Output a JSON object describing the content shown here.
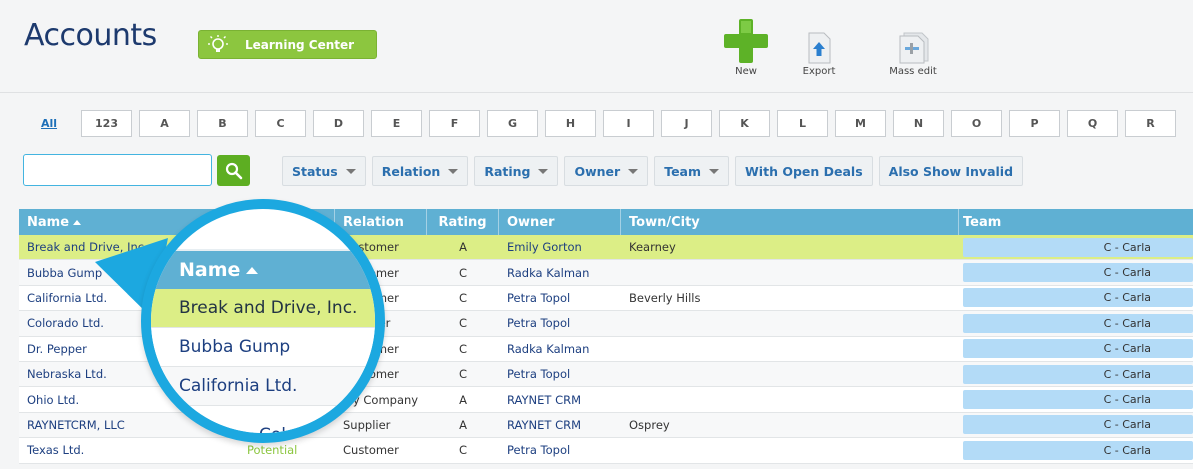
{
  "header": {
    "title": "Accounts",
    "learning_center_label": "Learning Center",
    "tools": [
      {
        "label": "New",
        "icon": "plus-icon"
      },
      {
        "label": "Export",
        "icon": "export-icon"
      },
      {
        "label": "Mass edit",
        "icon": "mass-edit-icon"
      }
    ]
  },
  "alphabet": [
    "All",
    "123",
    "A",
    "B",
    "C",
    "D",
    "E",
    "F",
    "G",
    "H",
    "I",
    "J",
    "K",
    "L",
    "M",
    "N",
    "O",
    "P",
    "Q",
    "R"
  ],
  "search": {
    "value": "",
    "placeholder": ""
  },
  "filters": [
    {
      "label": "Status",
      "dropdown": true
    },
    {
      "label": "Relation",
      "dropdown": true
    },
    {
      "label": "Rating",
      "dropdown": true
    },
    {
      "label": "Owner",
      "dropdown": true
    },
    {
      "label": "Team",
      "dropdown": true
    },
    {
      "label": "With Open Deals",
      "dropdown": false
    },
    {
      "label": "Also Show Invalid",
      "dropdown": false
    }
  ],
  "table": {
    "columns": [
      "Name",
      "",
      "Relation",
      "Rating",
      "Owner",
      "Town/City",
      "Team"
    ],
    "rows": [
      {
        "name": "Break and Drive, Inc.",
        "status": "",
        "relation": "Customer",
        "rating": "A",
        "owner": "Emily Gorton",
        "town": "Kearney",
        "team": "C - Carla"
      },
      {
        "name": "Bubba Gump",
        "status": "",
        "relation": "Customer",
        "rating": "C",
        "owner": "Radka Kalman",
        "town": "",
        "team": "C - Carla"
      },
      {
        "name": "California Ltd.",
        "status": "",
        "relation": "Customer",
        "rating": "C",
        "owner": "Petra Topol",
        "town": "Beverly Hills",
        "team": "C - Carla"
      },
      {
        "name": "Colorado Ltd.",
        "status": "",
        "relation": "Supplier",
        "rating": "C",
        "owner": "Petra Topol",
        "town": "",
        "team": "C - Carla"
      },
      {
        "name": "Dr. Pepper",
        "status": "",
        "relation": "Customer",
        "rating": "C",
        "owner": "Radka Kalman",
        "town": "",
        "team": "C - Carla"
      },
      {
        "name": "Nebraska Ltd.",
        "status": "",
        "relation": "Customer",
        "rating": "C",
        "owner": "Petra Topol",
        "town": "",
        "team": "C - Carla"
      },
      {
        "name": "Ohio Ltd.",
        "status": "",
        "relation": "My Company",
        "rating": "A",
        "owner": "RAYNET CRM",
        "town": "",
        "team": "C - Carla"
      },
      {
        "name": "RAYNETCRM, LLC",
        "status": "",
        "relation": "Supplier",
        "rating": "A",
        "owner": "RAYNET CRM",
        "town": "Osprey",
        "team": "C - Carla"
      },
      {
        "name": "Texas Ltd.",
        "status": "Potential",
        "relation": "Customer",
        "rating": "C",
        "owner": "Petra Topol",
        "town": "",
        "team": "C - Carla"
      }
    ]
  },
  "magnifier": {
    "header": "Name",
    "rows": [
      "Break and Drive, Inc.",
      "Bubba Gump",
      "California Ltd.",
      "Colorado Ltd."
    ]
  },
  "colors": {
    "accent_blue": "#5fb0d3",
    "magnifier_ring": "#1ca8e0",
    "selected_row": "#dcee86",
    "brand_green": "#8cc63f"
  }
}
